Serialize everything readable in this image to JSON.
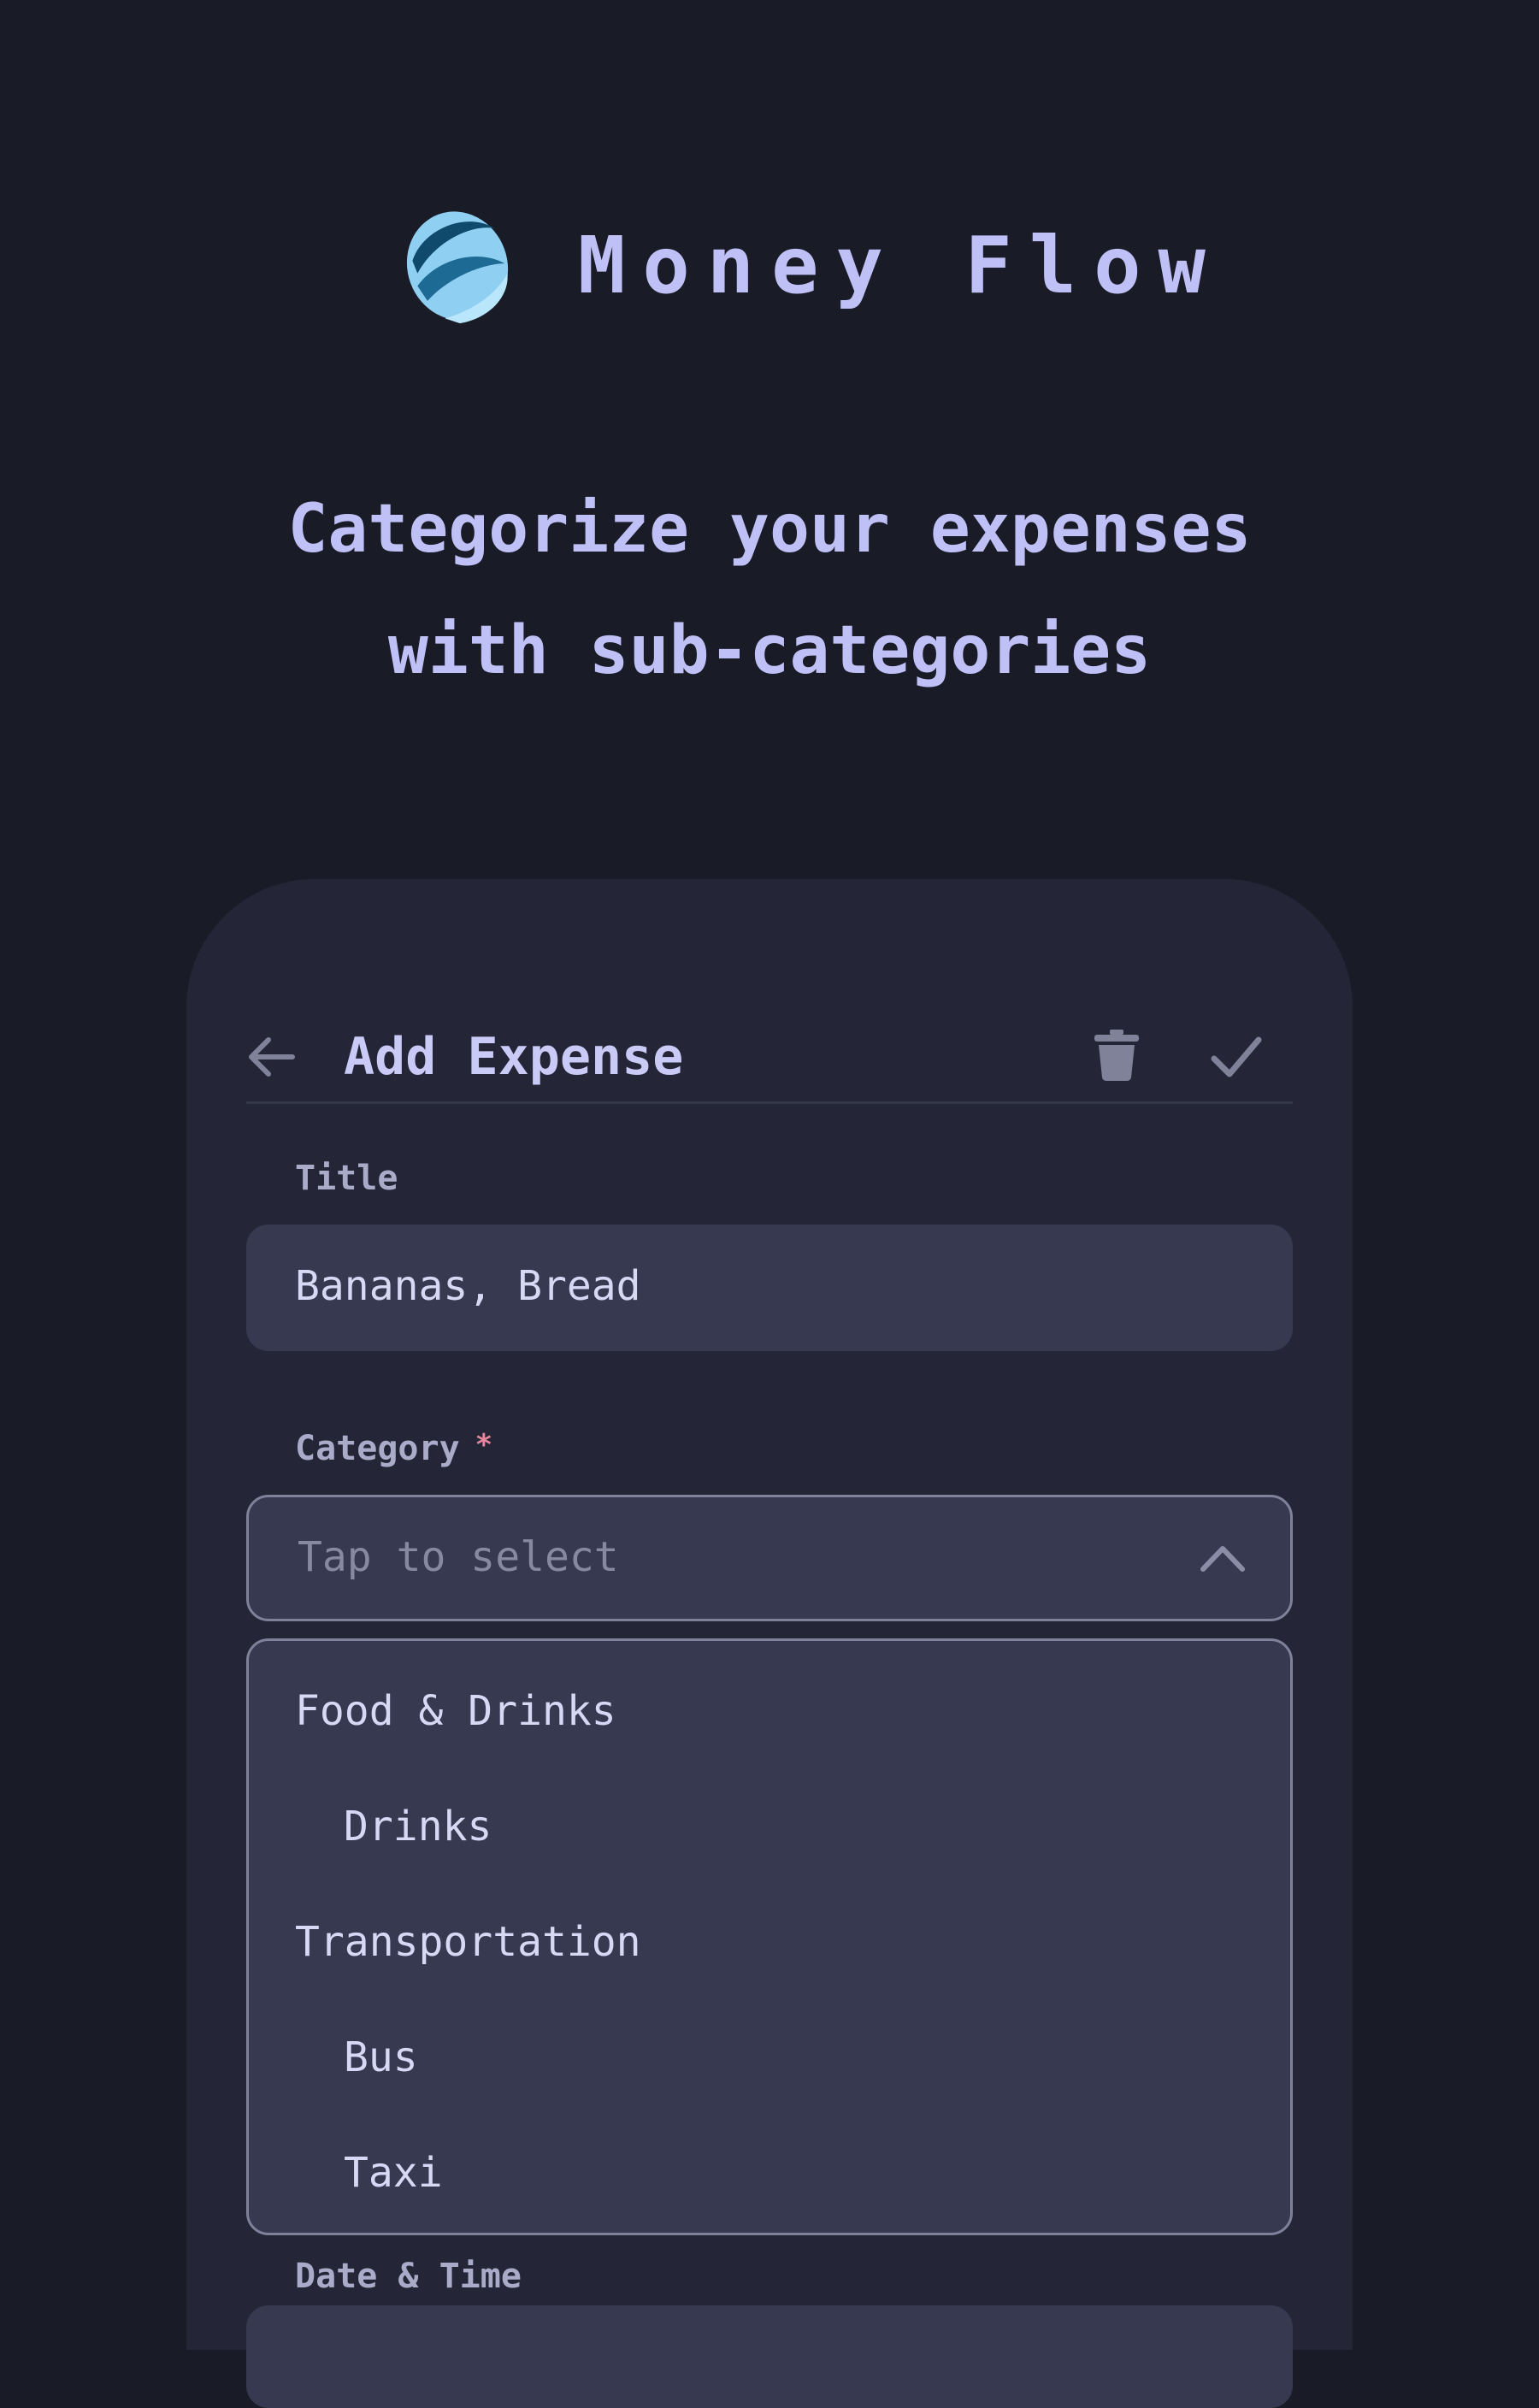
{
  "brand": {
    "name": "Money Flow",
    "logo_icon": "money-flow-logo",
    "accent_color": "#bfc0f6"
  },
  "headline": {
    "line1": "Categorize your expenses",
    "line2": "with sub-categories"
  },
  "screen": {
    "topbar": {
      "back_icon": "arrow-left-icon",
      "title": "Add Expense",
      "delete_icon": "trash-icon",
      "confirm_icon": "check-icon"
    },
    "title_field": {
      "label": "Title",
      "value": "Bananas, Bread"
    },
    "category_field": {
      "label": "Category",
      "required_mark": "*",
      "placeholder": "Tap to select",
      "expanded": true,
      "toggle_icon": "chevron-up-icon",
      "options": [
        {
          "label": "Food & Drinks",
          "level": 0
        },
        {
          "label": "Drinks",
          "level": 1
        },
        {
          "label": "Transportation",
          "level": 0
        },
        {
          "label": "Bus",
          "level": 1
        },
        {
          "label": "Taxi",
          "level": 1
        }
      ]
    },
    "date_field": {
      "label": "Date & Time"
    }
  },
  "colors": {
    "background": "#191b27",
    "card": "#242637",
    "input": "#363950",
    "required": "#e8869b"
  }
}
